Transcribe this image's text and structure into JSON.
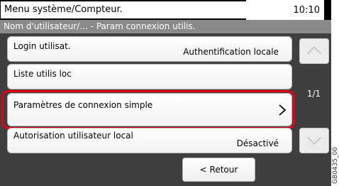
{
  "header": {
    "title": "Menu système/Compteur.",
    "time": "10:10",
    "breadcrumb": "Nom d'utilisateur/... - Param connexion utilis."
  },
  "list": {
    "items": [
      {
        "label": "Login utilisat.",
        "value": "Authentification locale"
      },
      {
        "label": "Liste utilis loc"
      },
      {
        "label": "Paramètres de connexion simple",
        "selected": true
      },
      {
        "label": "Autorisation utilisateur local",
        "value": "Désactivé"
      }
    ]
  },
  "pagination": {
    "indicator": "1/1"
  },
  "footer": {
    "back_label": "< Retour"
  },
  "image_code": "GB0435_00",
  "colors": {
    "highlight": "#e60012",
    "panel_background": "#3f3f3f",
    "subheader_background": "#8a8a8a"
  }
}
